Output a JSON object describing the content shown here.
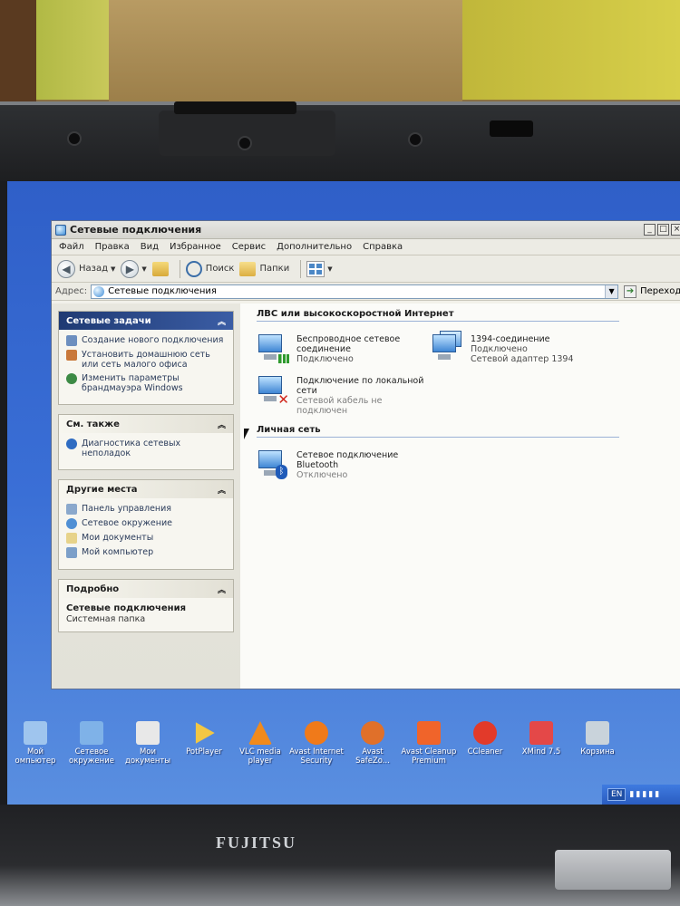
{
  "window": {
    "title": "Сетевые подключения",
    "controls": {
      "minimize": "_",
      "maximize": "□",
      "close": "×"
    }
  },
  "menu": [
    "Файл",
    "Правка",
    "Вид",
    "Избранное",
    "Сервис",
    "Дополнительно",
    "Справка"
  ],
  "toolbar": {
    "back": "Назад",
    "search": "Поиск",
    "folders": "Папки"
  },
  "address": {
    "label": "Адрес:",
    "value": "Сетевые подключения",
    "go": "Переход"
  },
  "left_panels": {
    "network_tasks": {
      "title": "Сетевые задачи",
      "items": [
        {
          "label": "Создание нового подключения",
          "icon": "new-connection-icon"
        },
        {
          "label": "Установить домашнюю сеть или сеть малого офиса",
          "icon": "home-network-icon"
        },
        {
          "label": "Изменить параметры брандмауэра Windows",
          "icon": "firewall-icon"
        }
      ]
    },
    "see_also": {
      "title": "См. также",
      "items": [
        {
          "label": "Диагностика сетевых неполадок",
          "icon": "info-icon"
        }
      ]
    },
    "other_places": {
      "title": "Другие места",
      "items": [
        {
          "label": "Панель управления",
          "icon": "control-panel-icon"
        },
        {
          "label": "Сетевое окружение",
          "icon": "network-places-icon"
        },
        {
          "label": "Мои документы",
          "icon": "documents-icon"
        },
        {
          "label": "Мой компьютер",
          "icon": "computer-icon"
        }
      ]
    },
    "details": {
      "title": "Подробно",
      "name": "Сетевые подключения",
      "type": "Системная папка"
    }
  },
  "content": {
    "lan_section": "ЛВС или высокоскоростной Интернет",
    "lan_items": [
      {
        "name1": "Беспроводное сетевое",
        "name2": "соединение",
        "status": "Подключено",
        "badge": "signal"
      },
      {
        "name1": "1394-соединение",
        "name2": "Подключено",
        "status": "Сетевой адаптер 1394",
        "badge": "none"
      },
      {
        "name1": "Подключение по локальной",
        "name2": "сети",
        "status": "Сетевой кабель не подключен",
        "badge": "x"
      }
    ],
    "pan_section": "Личная сеть",
    "pan_items": [
      {
        "name1": "Сетевое подключение",
        "name2": "Bluetooth",
        "status": "Отключено",
        "badge": "bluetooth"
      }
    ]
  },
  "desktop_icons": [
    {
      "label1": "Мой",
      "label2": "омпьютер",
      "color": "#9fc5ee"
    },
    {
      "label1": "Сетевое",
      "label2": "окружение",
      "color": "#7fb2e8"
    },
    {
      "label1": "Мои",
      "label2": "документы",
      "color": "#e8e8e8"
    },
    {
      "label1": "PotPlayer",
      "label2": "",
      "color": "#f2c744"
    },
    {
      "label1": "VLC media",
      "label2": "player",
      "color": "#f08a1c"
    },
    {
      "label1": "Avast Internet",
      "label2": "Security",
      "color": "#f07a1a"
    },
    {
      "label1": "Avast",
      "label2": "SafeZo...",
      "color": "#e0702a"
    },
    {
      "label1": "Avast Cleanup",
      "label2": "Premium",
      "color": "#f0642a"
    },
    {
      "label1": "CCleaner",
      "label2": "",
      "color": "#e23a2a"
    },
    {
      "label1": "XMind 7.5",
      "label2": "",
      "color": "#e44848"
    },
    {
      "label1": "Корзина",
      "label2": "",
      "color": "#c9d3db"
    }
  ],
  "tray": {
    "lang": "EN"
  },
  "device": {
    "brand": "FUJITSU"
  }
}
